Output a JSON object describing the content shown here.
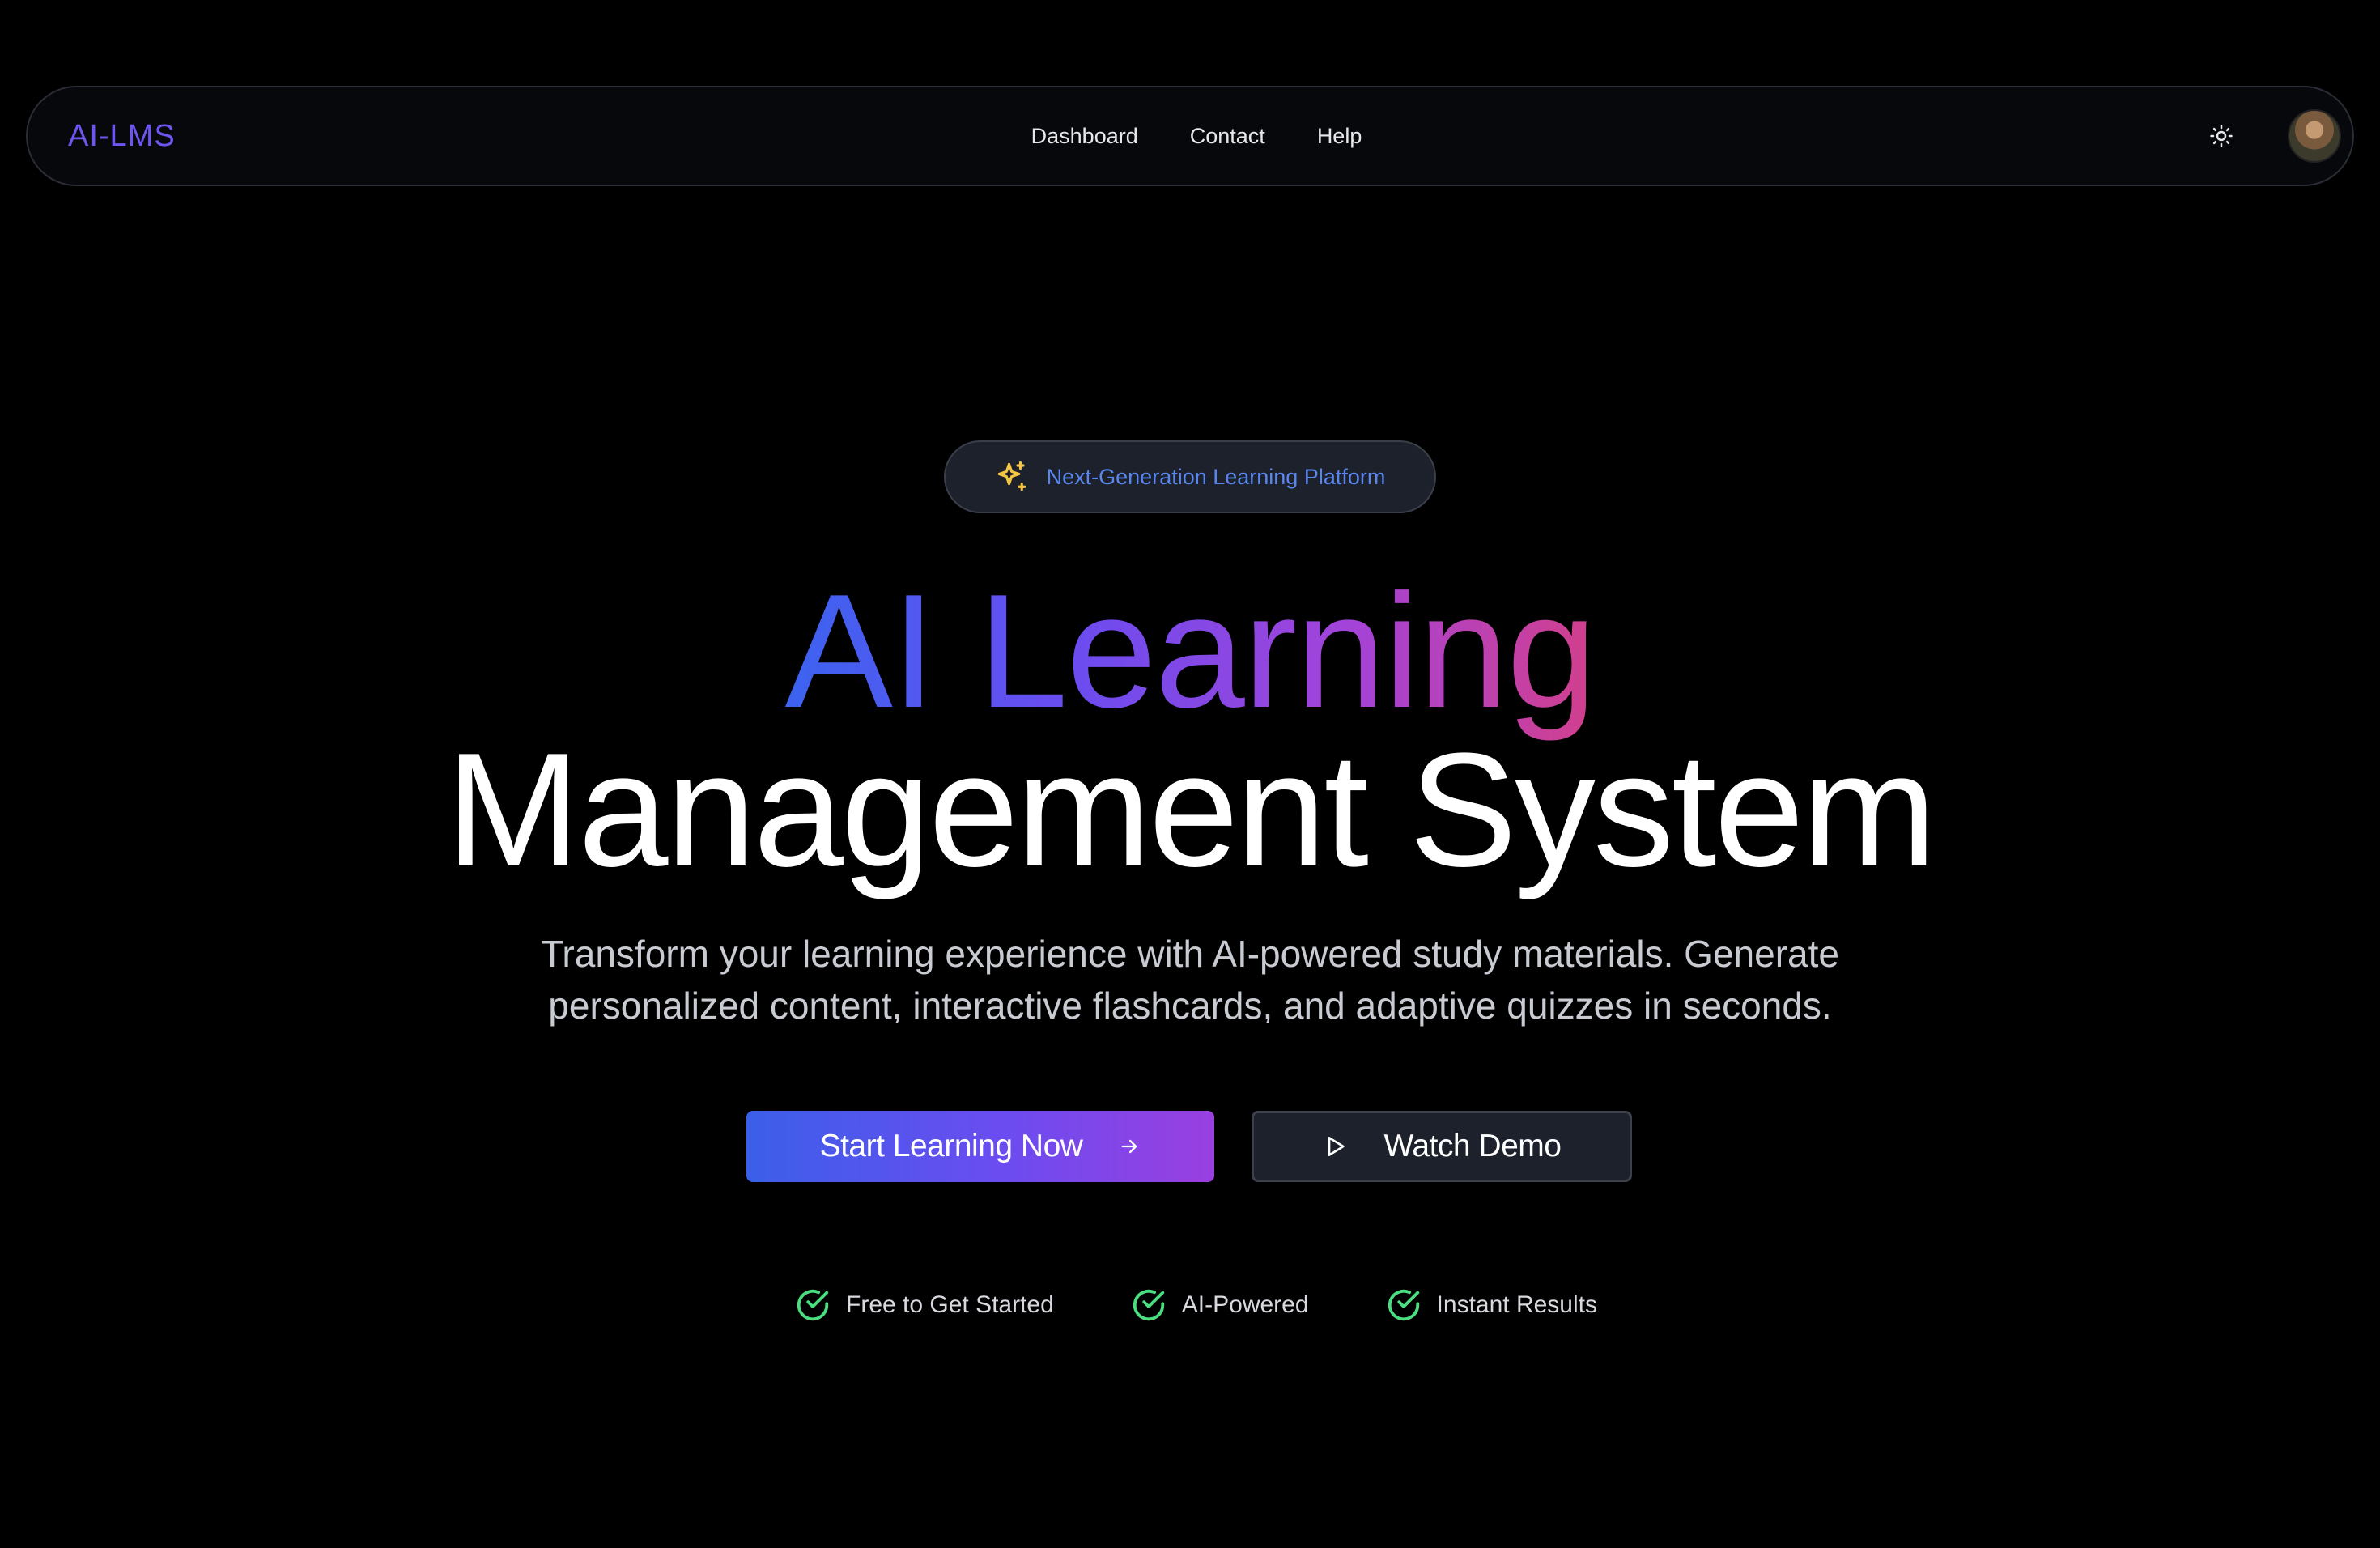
{
  "navbar": {
    "brand": "AI-LMS",
    "links": [
      "Dashboard",
      "Contact",
      "Help"
    ],
    "theme_icon": "sun-icon",
    "avatar_icon": "user-avatar"
  },
  "hero": {
    "badge_icon": "sparkles-icon",
    "badge": "Next-Generation Learning Platform",
    "headline_gradient": "AI Learning",
    "headline_plain": "Management System",
    "subtitle_line1": "Transform your learning experience with AI-powered study materials. Generate",
    "subtitle_line2": "personalized content, interactive flashcards, and adaptive quizzes in seconds.",
    "primary_cta": "Start Learning Now",
    "primary_cta_icon": "arrow-right-icon",
    "secondary_cta": "Watch Demo",
    "secondary_cta_icon": "play-icon",
    "features": [
      "Free to Get Started",
      "AI-Powered",
      "Instant Results"
    ],
    "feature_icon": "check-circle-icon"
  },
  "colors": {
    "background": "#000000",
    "brand": "#6d56f0",
    "badge_text": "#5b86ee",
    "gradient_start": "#3c63f0",
    "gradient_end": "#d23f8c",
    "check_green": "#4ade80",
    "sparkle_yellow": "#f5c542"
  }
}
